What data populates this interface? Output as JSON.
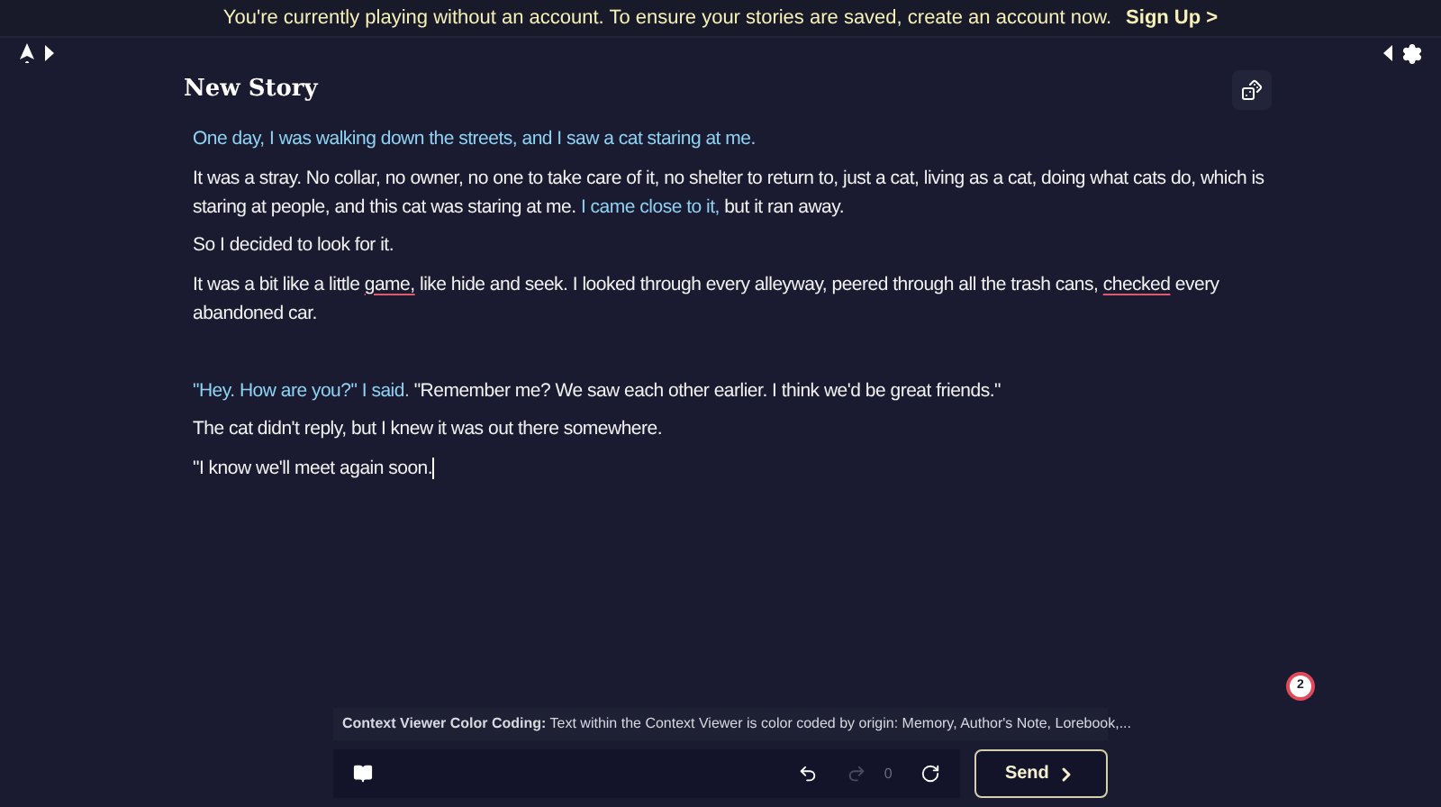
{
  "banner": {
    "message": "You're currently playing without an account. To ensure your stories are saved, create an account now.",
    "link": "Sign Up >"
  },
  "title": "New Story",
  "paragraphs": [
    {
      "segments": [
        {
          "kind": "prompt",
          "text": "One day, I was walking down the streets, and I saw a cat staring at me."
        }
      ]
    },
    {
      "segments": [
        {
          "kind": "ai",
          "text": "It was a stray. No collar, no owner, no one to take care of it, no shelter to return to, just a cat, living as a cat, doing what cats do, which is staring at people, and this cat was staring at me. "
        },
        {
          "kind": "prompt",
          "text": "I came close to it,"
        },
        {
          "kind": "ai",
          "text": " but it ran away."
        }
      ]
    },
    {
      "segments": [
        {
          "kind": "ai",
          "text": "So I decided to look for it."
        }
      ]
    },
    {
      "segments": [
        {
          "kind": "ai",
          "text": "It was a bit like a little "
        },
        {
          "kind": "flagged",
          "text": "game,"
        },
        {
          "kind": "ai",
          "text": " like hide and seek. I looked through every alleyway, peered through all the trash cans, "
        },
        {
          "kind": "flagged",
          "text": "checked"
        },
        {
          "kind": "ai",
          "text": " every abandoned car."
        }
      ]
    },
    {
      "kind": "blank"
    },
    {
      "segments": [
        {
          "kind": "prompt",
          "text": "\"Hey. How are you?\" I said."
        },
        {
          "kind": "ai",
          "text": " \"Remember me? We saw each other earlier. I think we'd be great friends.\""
        }
      ]
    },
    {
      "segments": [
        {
          "kind": "ai",
          "text": "The cat didn't reply, but I knew it was out there somewhere."
        }
      ]
    },
    {
      "segments": [
        {
          "kind": "ai",
          "text": "\"I know we'll meet again soon."
        }
      ]
    }
  ],
  "notification": {
    "count": "2"
  },
  "tip": {
    "label": "Context Viewer Color Coding:",
    "text": "Text within the Context Viewer is color coded by origin: Memory, Author's Note, Lorebook,..."
  },
  "toolbar": {
    "redo_disabled": true,
    "redo_count": "0",
    "send": "Send"
  }
}
